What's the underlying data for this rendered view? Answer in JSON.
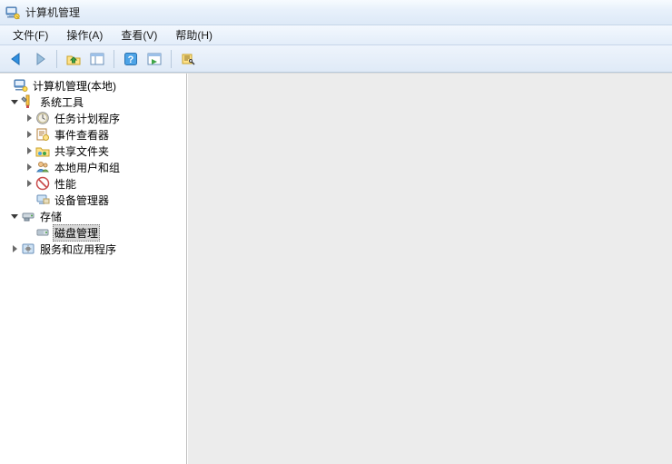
{
  "window": {
    "title": "计算机管理"
  },
  "menus": {
    "file": "文件(F)",
    "action": "操作(A)",
    "view": "查看(V)",
    "help": "帮助(H)"
  },
  "tree": {
    "root": "计算机管理(本地)",
    "system_tools": "系统工具",
    "task_scheduler": "任务计划程序",
    "event_viewer": "事件查看器",
    "shared_folders": "共享文件夹",
    "local_users_groups": "本地用户和组",
    "performance": "性能",
    "device_manager": "设备管理器",
    "storage": "存储",
    "disk_management": "磁盘管理",
    "services_apps": "服务和应用程序"
  },
  "icons": {
    "app": "computer-management",
    "back": "back",
    "forward": "forward",
    "up": "up-folder",
    "window": "window-panes",
    "help": "help",
    "play": "play-panel",
    "wizard": "wizard"
  }
}
